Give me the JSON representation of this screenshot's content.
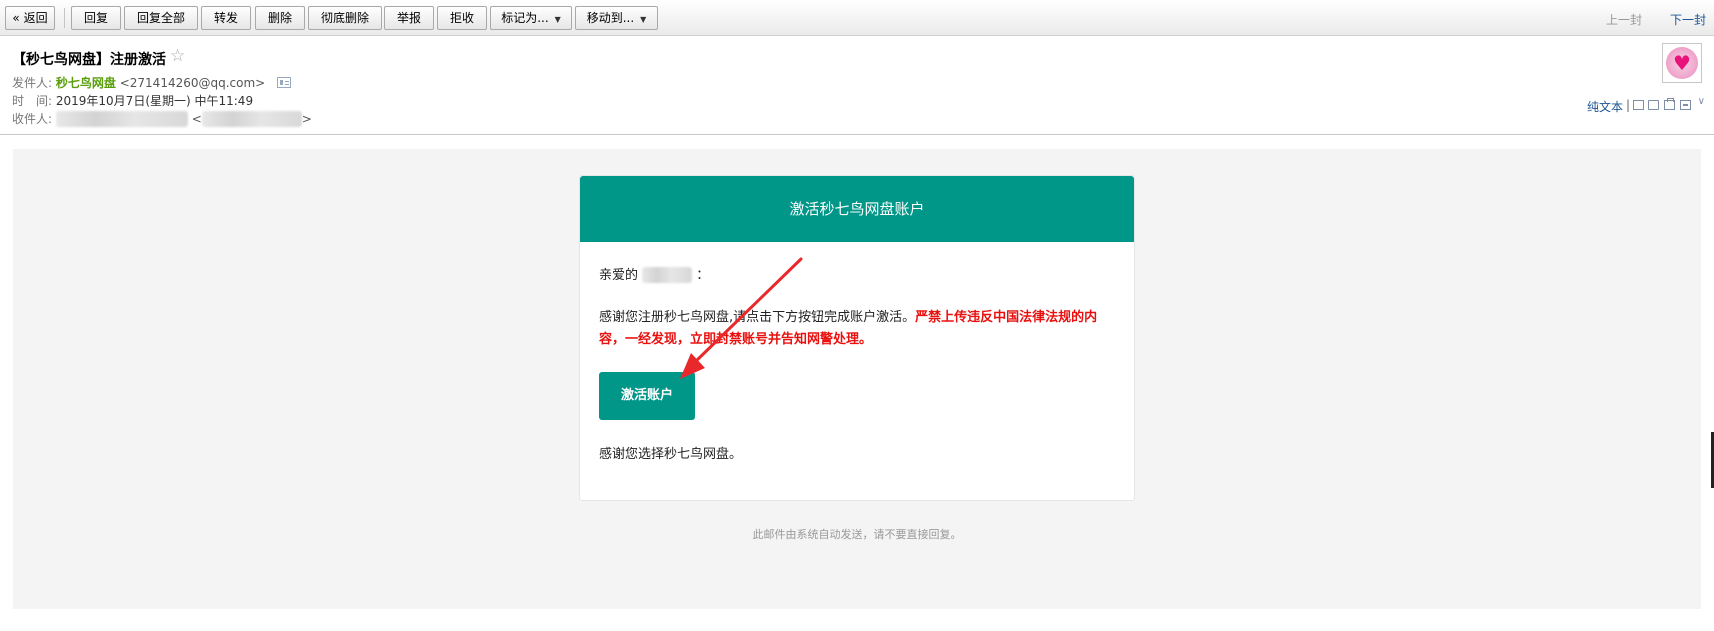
{
  "toolbar": {
    "back": "« 返回",
    "reply": "回复",
    "reply_all": "回复全部",
    "forward": "转发",
    "delete": "删除",
    "delete_forever": "彻底删除",
    "report": "举报",
    "reject": "拒收",
    "mark_as": "标记为...",
    "move_to": "移动到...",
    "prev_mail": "上一封",
    "next_mail": "下一封"
  },
  "header": {
    "subject": "【秒七鸟网盘】注册激活",
    "sender_label": "发件人:",
    "sender_name": "秒七鸟网盘",
    "sender_email": "<271414260@qq.com>",
    "time_label": "时　间:",
    "time_value": "2019年10月7日(星期一) 中午11:49",
    "recipient_label": "收件人:",
    "recipient_open": "<",
    "recipient_close": ">",
    "plain_text": "纯文本",
    "divider": "|"
  },
  "email": {
    "title": "激活秒七鸟网盘账户",
    "greeting_prefix": "亲爱的",
    "greeting_suffix": "：",
    "body_text": "感谢您注册秒七鸟网盘,请点击下方按钮完成账户激活。",
    "warning_text": "严禁上传违反中国法律法规的内容，一经发现，立即封禁账号并告知网警处理。",
    "activate_button": "激活账户",
    "thanks": "感谢您选择秒七鸟网盘。",
    "footer_note": "此邮件由系统自动发送，请不要直接回复。"
  },
  "colors": {
    "brand_teal": "#009688",
    "warning_red": "#e8110f",
    "arrow_red": "#e8282b",
    "sender_green": "#5a9f0b",
    "link_blue": "#1e5494"
  },
  "icons": {
    "star": "star-outline-icon",
    "contact_card": "contact-card-icon",
    "avatar": "heart-avatar-icon"
  }
}
